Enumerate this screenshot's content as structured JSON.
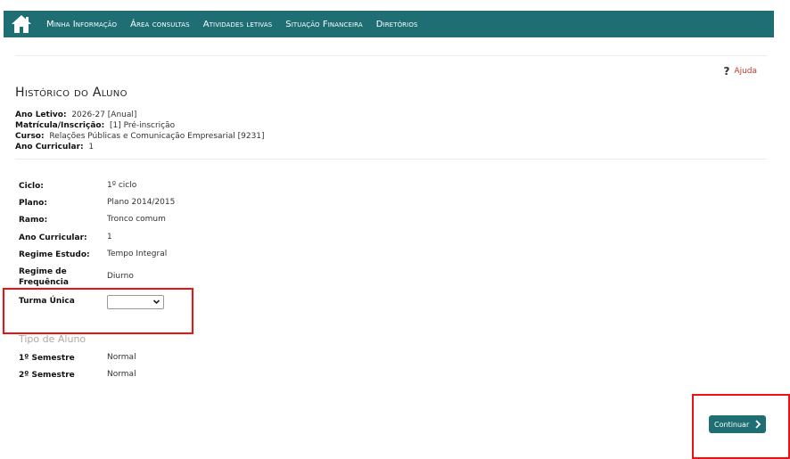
{
  "nav": {
    "items": [
      "Minha Informação",
      "Área consultas",
      "Atividades letivas",
      "Situação Financeira",
      "Diretórios"
    ]
  },
  "help": {
    "label": "Ajuda"
  },
  "page": {
    "title": "Histórico do Aluno"
  },
  "info": {
    "ano_letivo_label": "Ano Letivo:",
    "ano_letivo_value": "2026-27 [Anual]",
    "matricula_label": "Matrícula/Inscrição:",
    "matricula_value": "[1] Pré-inscrição",
    "curso_label": "Curso:",
    "curso_value": "Relações Públicas e Comunicação Empresarial [9231]",
    "ano_curricular_label": "Ano Curricular:",
    "ano_curricular_value": "1"
  },
  "fields": [
    {
      "label": "Ciclo:",
      "value": "1º ciclo"
    },
    {
      "label": "Plano:",
      "value": "Plano 2014/2015"
    },
    {
      "label": "Ramo:",
      "value": "Tronco comum"
    },
    {
      "label": "Ano Curricular:",
      "value": "1"
    },
    {
      "label": "Regime Estudo:",
      "value": "Tempo Integral"
    },
    {
      "label": "Regime de Frequência",
      "value": "Diurno"
    }
  ],
  "turma": {
    "label": "Turma Única",
    "selected": ""
  },
  "tipo_aluno": {
    "title": "Tipo de Aluno",
    "rows": [
      {
        "label": "1º Semestre",
        "value": "Normal"
      },
      {
        "label": "2º Semestre",
        "value": "Normal"
      }
    ]
  },
  "button": {
    "continuar": "Continuar"
  },
  "colors": {
    "brand": "#1f6e74",
    "highlight": "#e11111",
    "help": "#c0392b"
  },
  "icons": {
    "home": "home-icon",
    "help": "question-icon",
    "select": "chevron-down-icon",
    "continue": "chevron-right-icon"
  }
}
